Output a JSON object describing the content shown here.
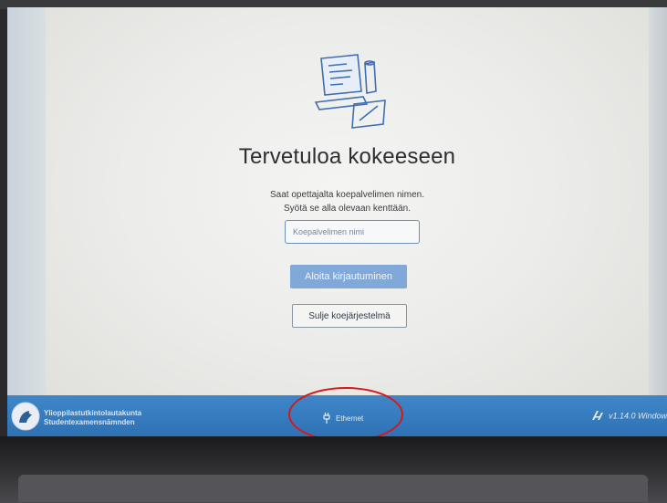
{
  "welcome": {
    "title": "Tervetuloa kokeeseen",
    "instruction_line1": "Saat opettajalta koepalvelimen nimen.",
    "instruction_line2": "Syötä se alla olevaan kenttään."
  },
  "server_input": {
    "placeholder": "Koepalvelimen nimi",
    "value": ""
  },
  "buttons": {
    "login_label": "Aloita kirjautuminen",
    "shutdown_label": "Sulje koejärjestelmä"
  },
  "footer": {
    "org_name_fi": "Ylioppilastutkintolautakunta",
    "org_name_sv": "Studentexamensnämnden",
    "network_status": "Ethernet",
    "network_icon": "ethernet-plug-icon",
    "version": "v1.14.0 Window",
    "version_icon": "abitti-logo-icon"
  },
  "colors": {
    "footer_blue": "#3579bb",
    "primary_button": "#80a8d8",
    "annotation_red": "#d81818"
  }
}
